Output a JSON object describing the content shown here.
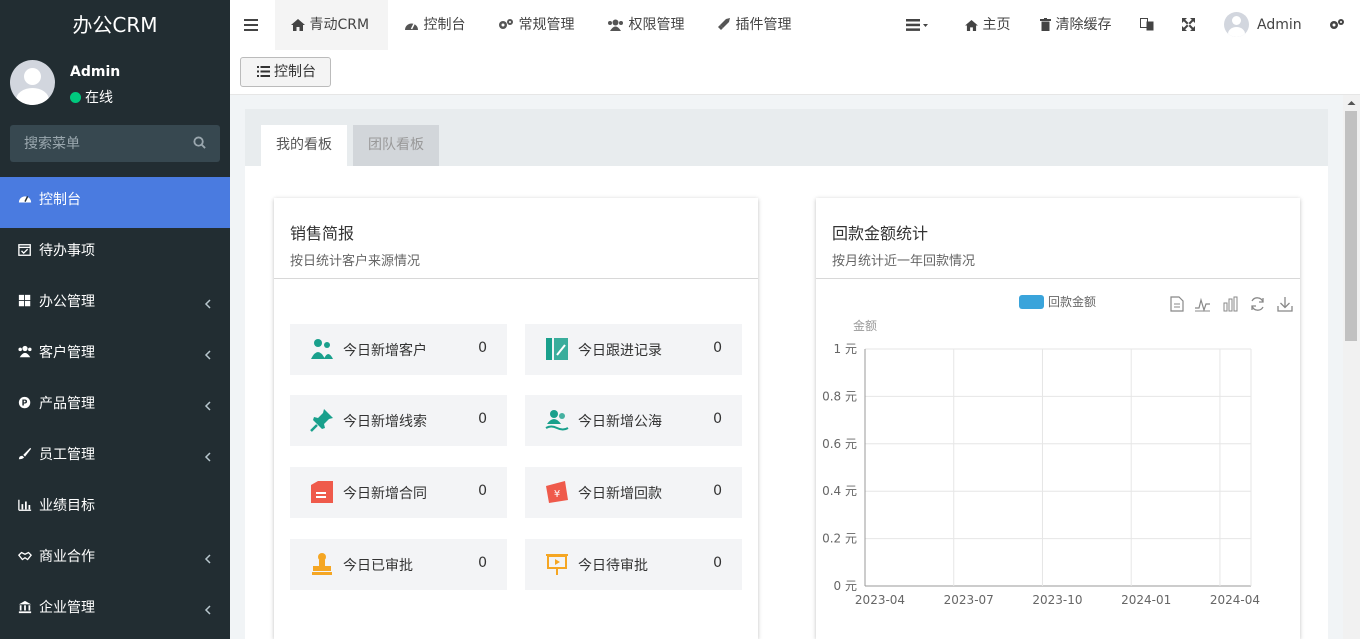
{
  "brand": "办公CRM",
  "user": {
    "name": "Admin",
    "status": "在线"
  },
  "search": {
    "placeholder": "搜索菜单"
  },
  "menu": [
    {
      "label": "控制台",
      "icon": "dashboard-icon",
      "active": true,
      "has_children": false
    },
    {
      "label": "待办事项",
      "icon": "calendar-check-icon",
      "active": false,
      "has_children": false
    },
    {
      "label": "办公管理",
      "icon": "windows-icon",
      "active": false,
      "has_children": true
    },
    {
      "label": "客户管理",
      "icon": "users-icon",
      "active": false,
      "has_children": true
    },
    {
      "label": "产品管理",
      "icon": "product-p-icon",
      "active": false,
      "has_children": true
    },
    {
      "label": "员工管理",
      "icon": "brush-icon",
      "active": false,
      "has_children": true
    },
    {
      "label": "业绩目标",
      "icon": "bar-chart-icon",
      "active": false,
      "has_children": false
    },
    {
      "label": "商业合作",
      "icon": "handshake-icon",
      "active": false,
      "has_children": true
    },
    {
      "label": "企业管理",
      "icon": "bank-icon",
      "active": false,
      "has_children": true
    }
  ],
  "topnav": {
    "items": [
      {
        "label": "青动CRM",
        "icon": "home-icon",
        "active": true
      },
      {
        "label": "控制台",
        "icon": "dashboard-icon",
        "active": false
      },
      {
        "label": "常规管理",
        "icon": "cogs-icon",
        "active": false
      },
      {
        "label": "权限管理",
        "icon": "users-icon",
        "active": false
      },
      {
        "label": "插件管理",
        "icon": "rocket-icon",
        "active": false
      }
    ],
    "right": {
      "home": "主页",
      "clear_cache": "清除缓存",
      "admin": "Admin"
    }
  },
  "subbar": {
    "button": "控制台"
  },
  "tabs": [
    {
      "label": "我的看板",
      "active": true
    },
    {
      "label": "团队看板",
      "active": false
    }
  ],
  "sales": {
    "title": "销售简报",
    "subtitle": "按日统计客户来源情况",
    "stats": [
      {
        "label": "今日新增客户",
        "value": "0",
        "icon": "customer-add-icon",
        "color": "#19a08c"
      },
      {
        "label": "今日跟进记录",
        "value": "0",
        "icon": "follow-record-icon",
        "color": "#19a08c"
      },
      {
        "label": "今日新增线索",
        "value": "0",
        "icon": "pushpin-icon",
        "color": "#19a08c"
      },
      {
        "label": "今日新增公海",
        "value": "0",
        "icon": "sea-users-icon",
        "color": "#19a08c"
      },
      {
        "label": "今日新增合同",
        "value": "0",
        "icon": "contract-icon",
        "color": "#ef5a4b"
      },
      {
        "label": "今日新增回款",
        "value": "0",
        "icon": "payment-yen-icon",
        "color": "#ef5a4b"
      },
      {
        "label": "今日已审批",
        "value": "0",
        "icon": "stamp-icon",
        "color": "#f5a623"
      },
      {
        "label": "今日待审批",
        "value": "0",
        "icon": "easel-icon",
        "color": "#f5a623"
      }
    ]
  },
  "payment": {
    "title": "回款金额统计",
    "subtitle": "按月统计近一年回款情况"
  },
  "chart_data": {
    "type": "bar",
    "ylabel": "金额",
    "x": [
      "2023-04",
      "2023-07",
      "2023-10",
      "2024-01",
      "2024-04"
    ],
    "y_ticks": [
      "0 元",
      "0.2 元",
      "0.4 元",
      "0.6 元",
      "0.8 元",
      "1 元"
    ],
    "ylim": [
      0,
      1
    ],
    "series": [
      {
        "name": "回款金额",
        "values": [
          0,
          0,
          0,
          0,
          0
        ],
        "color": "#3aa4db"
      }
    ],
    "grid": true,
    "legend": "top"
  }
}
